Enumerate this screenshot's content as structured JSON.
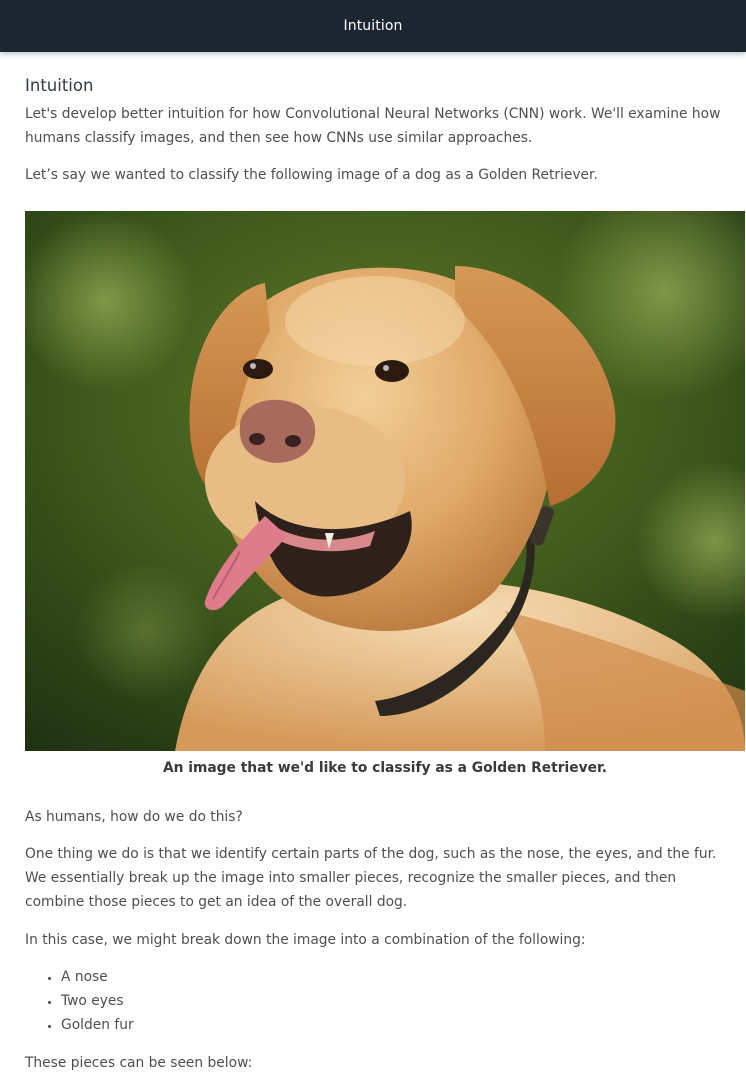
{
  "header": {
    "title": "Intuition"
  },
  "article": {
    "heading": "Intuition",
    "intro": "Let's develop better intuition for how Convolutional Neural Networks (CNN) work. We'll examine how humans classify images, and then see how CNNs use similar approaches.",
    "classify_sentence": "Let’s say we wanted to classify the following image of a dog as a Golden Retriever.",
    "image_caption": "An image that we'd like to classify as a Golden Retriever.",
    "question": "As humans, how do we do this?",
    "explanation": "One thing we do is that we identify certain parts of the dog, such as the nose, the eyes, and the fur. We essentially break up the image into smaller pieces, recognize the smaller pieces, and then combine those pieces to get an idea of the overall dog.",
    "list_intro": "In this case, we might break down the image into a combination of the following:",
    "parts": [
      "A nose",
      "Two eyes",
      "Golden fur"
    ],
    "pieces_sentence": "These pieces can be seen below:"
  },
  "colors": {
    "header_bg": "#1c2630",
    "header_text": "#ffffff",
    "body_text": "#4f4f4f",
    "heading_text": "#2e3d49"
  }
}
